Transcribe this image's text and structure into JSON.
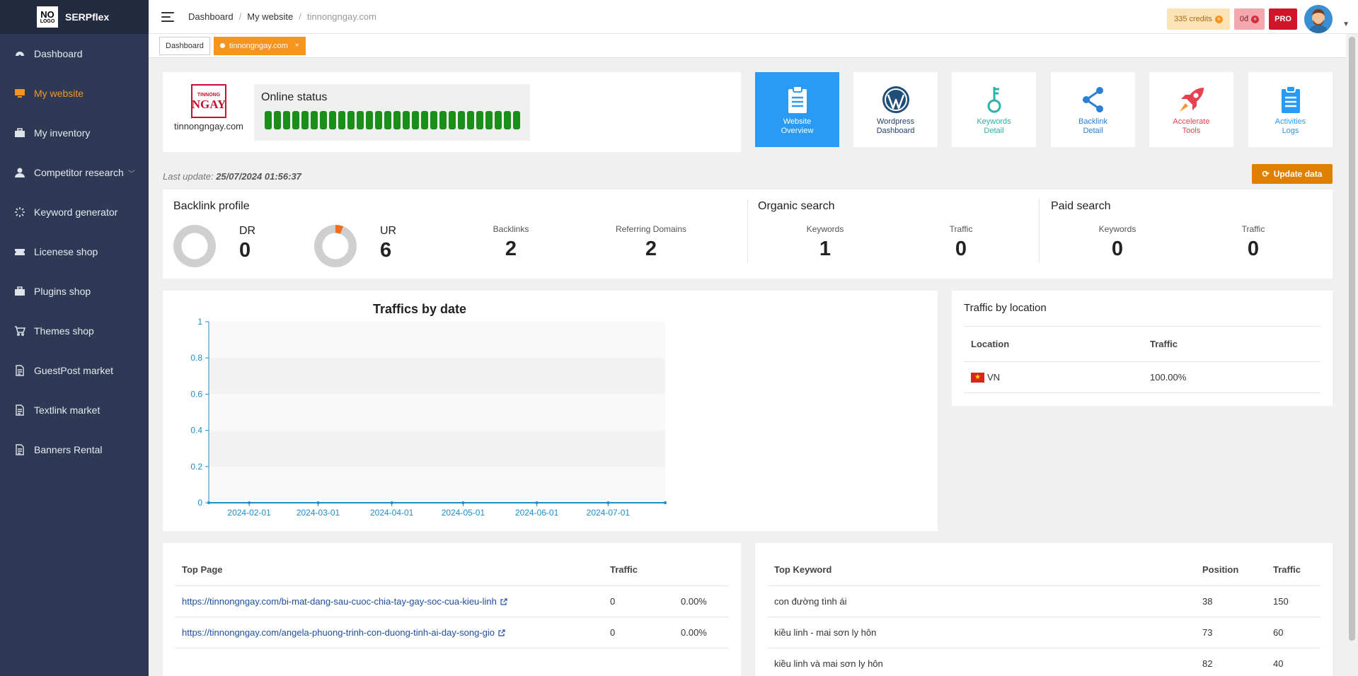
{
  "brand": {
    "logo_line1": "NO",
    "logo_line2": "LOGO",
    "name": "SERPflex"
  },
  "sidebar": {
    "items": [
      {
        "label": "Dashboard",
        "icon": "dashboard-icon"
      },
      {
        "label": "My website",
        "icon": "monitor-icon",
        "active": true
      },
      {
        "label": "My inventory",
        "icon": "briefcase-icon"
      },
      {
        "label": "Competitor research",
        "icon": "user-icon"
      },
      {
        "label": "Keyword generator",
        "icon": "spinner-icon"
      },
      {
        "label": "Licenese shop",
        "icon": "ticket-icon"
      },
      {
        "label": "Plugins shop",
        "icon": "briefcase-icon"
      },
      {
        "label": "Themes shop",
        "icon": "cart-icon"
      },
      {
        "label": "GuestPost market",
        "icon": "document-icon"
      },
      {
        "label": "Textlink market",
        "icon": "document-icon"
      },
      {
        "label": "Banners Rental",
        "icon": "document-icon"
      }
    ]
  },
  "breadcrumb": {
    "item1": "Dashboard",
    "item2": "My website",
    "current": "tinnongngay.com"
  },
  "topright": {
    "credits": "335 credits",
    "money": "0đ",
    "pro": "PRO"
  },
  "tabs": {
    "tab1": "Dashboard",
    "tab2": "tinnongngay.com",
    "close": "×"
  },
  "site": {
    "logo_line1": "TINNONG",
    "logo_line2": "NGAY",
    "name": "tinnongngay.com",
    "status_title": "Online status",
    "status_level": 1.0
  },
  "tools": [
    {
      "label1": "Website",
      "label2": "Overview",
      "icon": "clipboard-icon"
    },
    {
      "label1": "Wordpress",
      "label2": "Dashboard",
      "icon": "wordpress-icon"
    },
    {
      "label1": "Keywords",
      "label2": "Detail",
      "icon": "key-icon"
    },
    {
      "label1": "Backlink",
      "label2": "Detail",
      "icon": "share-icon"
    },
    {
      "label1": "Accelerate",
      "label2": "Tools",
      "icon": "rocket-icon"
    },
    {
      "label1": "Activities",
      "label2": "Logs",
      "icon": "clipboard-icon"
    }
  ],
  "update": {
    "prefix": "Last update:",
    "time": "25/07/2024 01:56:37",
    "button": "Update data"
  },
  "backlink": {
    "title": "Backlink profile",
    "dr_label": "DR",
    "dr_value": "0",
    "ur_label": "UR",
    "ur_value": "6",
    "backlinks_label": "Backlinks",
    "backlinks_value": "2",
    "domains_label": "Referring Domains",
    "domains_value": "2"
  },
  "organic": {
    "title": "Organic search",
    "kw_label": "Keywords",
    "kw_value": "1",
    "tr_label": "Traffic",
    "tr_value": "0"
  },
  "paid": {
    "title": "Paid search",
    "kw_label": "Keywords",
    "kw_value": "0",
    "tr_label": "Traffic",
    "tr_value": "0"
  },
  "chart_data": {
    "type": "line",
    "title": "Traffics by date",
    "x": [
      "2024-01-15",
      "2024-02-01",
      "2024-03-01",
      "2024-04-01",
      "2024-05-01",
      "2024-06-01",
      "2024-07-01",
      "2024-07-25"
    ],
    "tick_labels": [
      "2024-02-01",
      "2024-03-01",
      "2024-04-01",
      "2024-05-01",
      "2024-06-01",
      "2024-07-01"
    ],
    "y_ticks": [
      "0",
      "0.2",
      "0.4",
      "0.6",
      "0.8",
      "1"
    ],
    "series": [
      {
        "values": [
          0,
          0,
          0,
          0,
          0,
          0,
          0,
          0
        ]
      }
    ],
    "ylim": [
      0,
      1
    ],
    "grid": true,
    "color": "#1a8fc9"
  },
  "location": {
    "title": "Traffic by location",
    "col_location": "Location",
    "col_traffic": "Traffic",
    "rows": [
      {
        "flag": "vietnam-flag-icon",
        "code": "VN",
        "traffic": "100.00%"
      }
    ]
  },
  "top_page": {
    "col_page": "Top Page",
    "col_traffic": "Traffic",
    "rows": [
      {
        "url": "https://tinnongngay.com/bi-mat-dang-sau-cuoc-chia-tay-gay-soc-cua-kieu-linh",
        "traffic": "0",
        "pct": "0.00%"
      },
      {
        "url": "https://tinnongngay.com/angela-phuong-trinh-con-duong-tinh-ai-day-song-gio",
        "traffic": "0",
        "pct": "0.00%"
      }
    ]
  },
  "top_keyword": {
    "col_kw": "Top Keyword",
    "col_pos": "Position",
    "col_traffic": "Traffic",
    "rows": [
      {
        "kw": "con đường tình ái",
        "pos": "38",
        "traffic": "150"
      },
      {
        "kw": "kiều linh - mai sơn ly hôn",
        "pos": "73",
        "traffic": "60"
      },
      {
        "kw": "kiều linh và mai sơn ly hôn",
        "pos": "82",
        "traffic": "40"
      }
    ]
  },
  "colors": {
    "sidebar": "#2e3a55",
    "accent": "#f7941d",
    "primary": "#2b9af3",
    "pro": "#d0142a"
  }
}
